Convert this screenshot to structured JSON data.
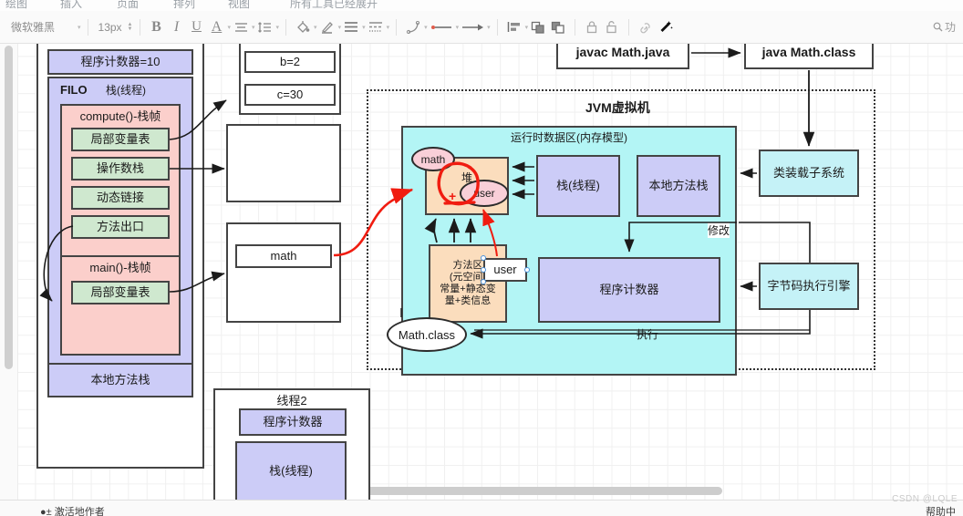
{
  "menubar": {
    "items": [
      "绘图",
      "插入",
      "页面",
      "排列",
      "视图",
      "所有工具已经展开"
    ]
  },
  "toolbar": {
    "font_name": "微软雅黑",
    "font_size": "13px",
    "bold_label": "B",
    "italic_label": "I",
    "underline_label": "U",
    "text_color_label": "A",
    "icons": [
      "font-name-select",
      "font-size-stepper",
      "bold-icon",
      "italic-icon",
      "underline-icon",
      "text-color-icon",
      "align-icon",
      "line-spacing-icon",
      "fill-color-icon",
      "line-color-icon",
      "line-style-icon",
      "dash-style-icon",
      "curve-icon",
      "line-start-icon",
      "line-end-icon",
      "align-objects-icon",
      "bring-forward-icon",
      "send-backward-icon",
      "lock-icon",
      "unlock-icon",
      "link-icon",
      "magic-wand-icon"
    ],
    "search_label": "功"
  },
  "diagram": {
    "left_thread": {
      "pc_counter": "程序计数器=10",
      "stack_title_filo": "FILO",
      "stack_title": "栈(线程)",
      "compute_frame": "compute()-栈帧",
      "compute_rows": [
        "局部变量表",
        "操作数栈",
        "动态链接",
        "方法出口"
      ],
      "main_frame": "main()-栈帧",
      "main_rows": [
        "局部变量表"
      ],
      "native_stack": "本地方法栈"
    },
    "middle_column": {
      "var_b": "b=2",
      "var_c": "c=30",
      "empty_box": "",
      "math_ref": "math"
    },
    "thread2": {
      "title": "线程2",
      "pc_counter": "程序计数器",
      "stack": "栈(线程)"
    },
    "top_flow": {
      "compile_cmd": "javac Math.java",
      "run_cmd": "java Math.class"
    },
    "jvm": {
      "title": "JVM虚拟机",
      "runtime_area_title": "运行时数据区(内存模型)",
      "heap_label": "堆",
      "heap_annotation": "+",
      "heap_obj_math": "math",
      "heap_obj_user": "user",
      "method_area": "方法区\n(元空间)\n常量+静态变\n量+类信息",
      "method_area_lines": [
        "方法区",
        "(元空间)",
        "常量+静态变",
        "量+类信息"
      ],
      "stack_thread": "栈(线程)",
      "native_method_stack": "本地方法栈",
      "pc_counter": "程序计数器",
      "math_class": "Math.class",
      "selected_shape_label": "user",
      "class_loader": "类装载子系统",
      "bytecode_engine": "字节码执行引擎",
      "edge_modify": "修改",
      "edge_execute": "执行"
    }
  },
  "statusbar": {
    "left_text": "●± 激活地作者",
    "right_text": "帮助中"
  },
  "watermark": "CSDN @LQLE",
  "colors": {
    "lavender": "#ccccf7",
    "pink": "#fbcfcb",
    "green": "#cfe8cf",
    "cyan": "#b3f5f5",
    "cyan_light": "#c5f2f7",
    "peach": "#fbddbd",
    "annotation_red": "#f01c10",
    "stroke": "#2b2b2b"
  }
}
